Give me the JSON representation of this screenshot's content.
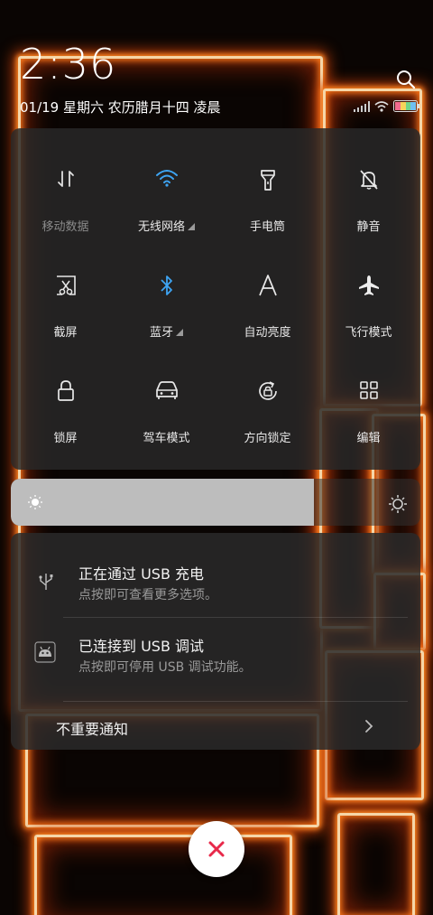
{
  "status_bar": {
    "time": "2:36",
    "date": "01/19  星期六  农历腊月十四  凌晨",
    "icons": [
      "signal-icon",
      "wifi-icon",
      "battery-icon"
    ]
  },
  "quick_settings": {
    "tiles": [
      {
        "label": "移动数据",
        "icon": "mobile-data-icon",
        "active": false,
        "disabled": true
      },
      {
        "label": "无线网络",
        "icon": "wifi-icon",
        "active": true,
        "has_more": true
      },
      {
        "label": "手电筒",
        "icon": "flashlight-icon",
        "active": false
      },
      {
        "label": "静音",
        "icon": "mute-bell-icon",
        "active": false
      },
      {
        "label": "截屏",
        "icon": "screenshot-icon",
        "active": false
      },
      {
        "label": "蓝牙",
        "icon": "bluetooth-icon",
        "active": true,
        "has_more": true
      },
      {
        "label": "自动亮度",
        "icon": "auto-brightness-icon",
        "active": false
      },
      {
        "label": "飞行模式",
        "icon": "airplane-icon",
        "active": false
      },
      {
        "label": "锁屏",
        "icon": "lock-icon",
        "active": false
      },
      {
        "label": "驾车模式",
        "icon": "car-icon",
        "active": false
      },
      {
        "label": "方向锁定",
        "icon": "rotation-lock-icon",
        "active": false
      },
      {
        "label": "编辑",
        "icon": "grid-edit-icon",
        "active": false
      }
    ]
  },
  "brightness": {
    "level": 0.74
  },
  "notifications": {
    "items": [
      {
        "title": "正在通过 USB 充电",
        "subtitle": "点按即可查看更多选项。",
        "icon": "usb-icon"
      },
      {
        "title": "已连接到 USB 调试",
        "subtitle": "点按即可停用 USB 调试功能。",
        "icon": "android-debug-icon"
      }
    ],
    "unimportant_label": "不重要通知"
  },
  "colors": {
    "accent": "#3ea4f2",
    "close_icon": "#e8294a"
  }
}
